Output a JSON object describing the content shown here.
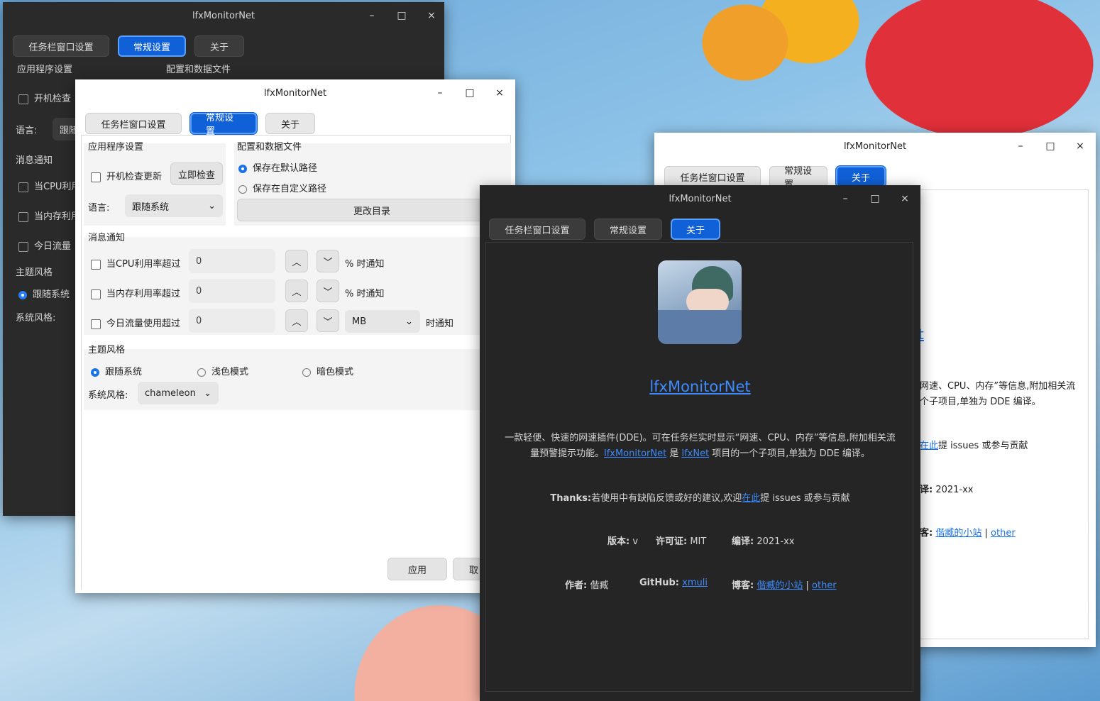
{
  "app_title": "lfxMonitorNet",
  "tabs": [
    "任务栏窗口设置",
    "常规设置",
    "关于"
  ],
  "controls": {
    "minimize": "–",
    "maximize": "□",
    "close": "×"
  },
  "general": {
    "app_settings_header": "应用程序设置",
    "config_header": "配置和数据文件",
    "auto_check_update": "开机检查更新",
    "check_now": "立即检查",
    "language_label": "语言:",
    "language_value": "跟随系统",
    "save_default": "保存在默认路径",
    "save_custom": "保存在自定义路径",
    "change_dir": "更改目录",
    "notify_header": "消息通知",
    "cpu_notify": "当CPU利用率超过",
    "mem_notify": "当内存利用率超过",
    "traffic_notify": "今日流量使用超过",
    "cpu_value": "0",
    "mem_value": "0",
    "traffic_value": "0",
    "percent_notify": "% 时通知",
    "unit_value": "MB",
    "time_notify": "时通知",
    "theme_header": "主题风格",
    "theme_follow": "跟随系统",
    "theme_light": "浅色模式",
    "theme_dark": "暗色模式",
    "style_label": "系统风格:",
    "style_value": "chameleon",
    "apply": "应用",
    "cancel": "取"
  },
  "dark_partial": {
    "auto_check": "开机检查",
    "language_value": "跟随",
    "cpu_notify": "当CPU利用",
    "mem_notify": "当内存利用",
    "traffic_notify": "今日流量",
    "theme_follow": "跟随系统",
    "style_label": "系统风格:"
  },
  "about": {
    "app_name": "lfxMonitorNet",
    "desc_line1": "一款轻便、快速的网速插件(DDE)。可在任务栏实时显示“网速、CPU、内存”等信息,附加相关流",
    "desc_line2_pre": "量预警提示功能。",
    "desc_link1": "lfxMonitorNet",
    "desc_mid": " 是 ",
    "desc_link2": "lfxNet",
    "desc_post": " 项目的一个子项目,单独为 DDE 编译。",
    "thanks_label": "Thanks:",
    "thanks_text": "若使用中有缺陷反馈或好的建议,欢迎",
    "thanks_link": "在此",
    "thanks_post": "提 issues 或参与贡献",
    "version_label": "版本:",
    "version_value": "v",
    "license_label": "许可证:",
    "license_value": "MIT",
    "build_label": "编译:",
    "build_value": "2021-xx",
    "author_label": "作者:",
    "author_value": "偕臧",
    "github_label": "GitHub:",
    "github_value": "xmuli",
    "blog_label": "博客:",
    "blog_link": "偕臧的小站",
    "sep": "|",
    "other_link": "other"
  },
  "about_light_partial": {
    "link_tail": "t",
    "desc_a": "网速、CPU、内存”等信息,附加相关流",
    "desc_b": "个子项目,单独为 DDE 编译。",
    "thanks_link": "在此",
    "thanks_post": "提 issues 或参与贡献",
    "build_tail": "译:",
    "build_value": "2021-xx",
    "blog_tail": "客:",
    "blog_link": "偕臧的小站",
    "sep": "|",
    "other_link": "other"
  }
}
